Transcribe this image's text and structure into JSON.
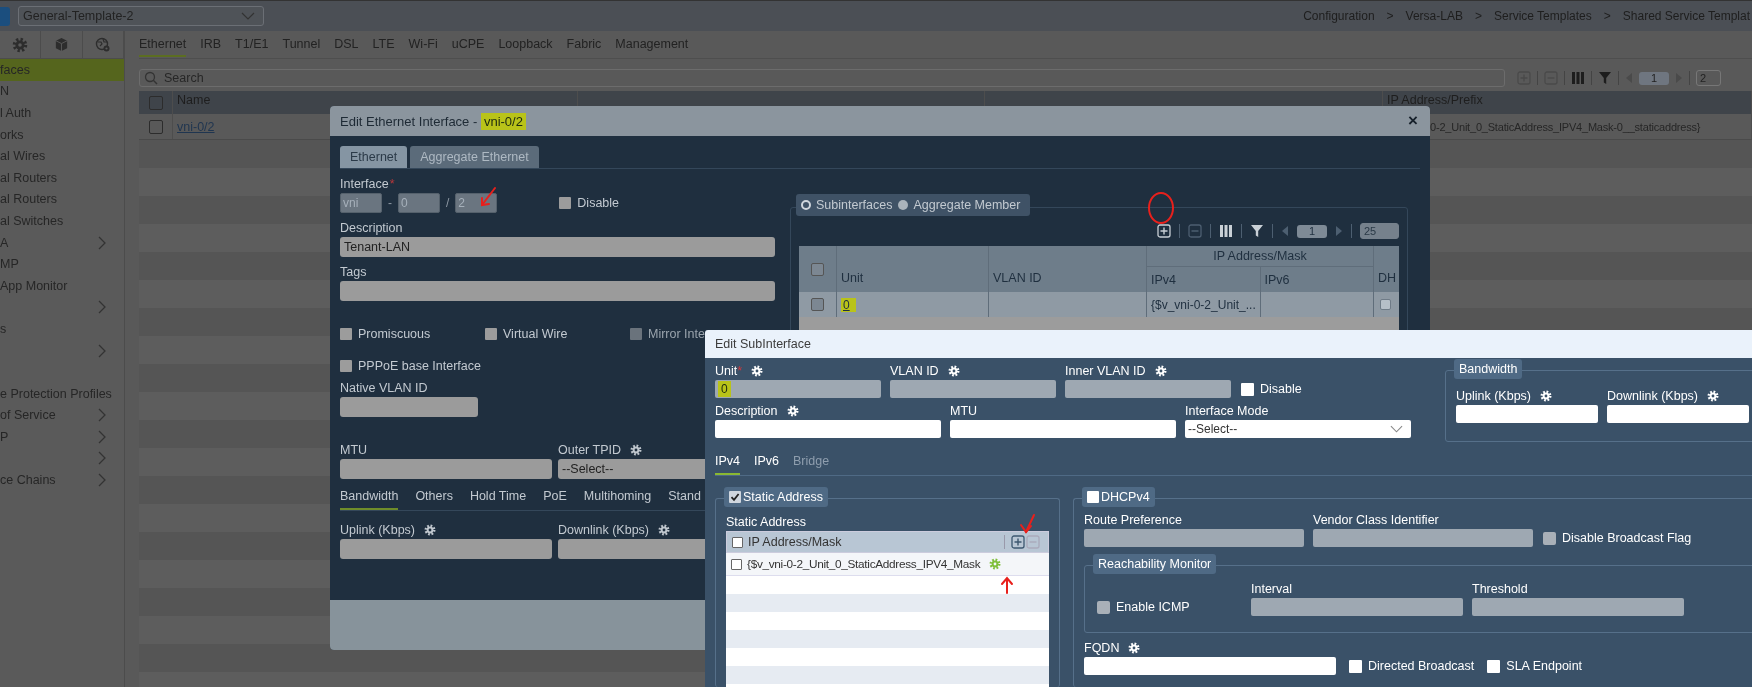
{
  "top_bar": {
    "template": "General-Template-2",
    "breadcrumb": [
      {
        "label": "Configuration"
      },
      {
        "separator": ">",
        "label": "Versa-LAB"
      },
      {
        "separator": ">",
        "label": "Service Templates"
      },
      {
        "separator": ">",
        "label": "Shared Service Templat"
      }
    ]
  },
  "sidebar": {
    "items": [
      {
        "label": "faces",
        "selected": true,
        "expandable": false
      },
      {
        "label": "N",
        "selected": false,
        "expandable": false
      },
      {
        "label": "l Auth",
        "selected": false,
        "expandable": false
      },
      {
        "label": "orks",
        "selected": false,
        "expandable": false
      },
      {
        "label": "al Wires",
        "selected": false,
        "expandable": false
      },
      {
        "label": "al Routers",
        "selected": false,
        "expandable": false
      },
      {
        "label": "al Routers",
        "selected": false,
        "expandable": false
      },
      {
        "label": "al Switches",
        "selected": false,
        "expandable": false
      },
      {
        "label": "A",
        "selected": false,
        "expandable": true
      },
      {
        "label": "MP",
        "selected": false,
        "expandable": false
      },
      {
        "label": "App Monitor",
        "selected": false,
        "expandable": false
      },
      {
        "selected": false,
        "expandable": true
      },
      {
        "label": "s",
        "selected": false,
        "expandable": false
      },
      {
        "selected": false,
        "expandable": true
      },
      {
        "selected": false,
        "expandable": false
      },
      {
        "label": "e Protection Profiles",
        "selected": false,
        "expandable": false
      },
      {
        "label": "of Service",
        "selected": false,
        "expandable": true
      },
      {
        "label": "P",
        "selected": false,
        "expandable": true
      },
      {
        "selected": false,
        "expandable": true
      },
      {
        "label": "ce Chains",
        "selected": false,
        "expandable": true
      }
    ]
  },
  "main": {
    "tabs": [
      {
        "label": "Ethernet",
        "selected": true
      },
      {
        "label": "IRB",
        "selected": false
      },
      {
        "label": "T1/E1",
        "selected": false
      },
      {
        "label": "Tunnel",
        "selected": false
      },
      {
        "label": "DSL",
        "selected": false
      },
      {
        "label": "LTE",
        "selected": false
      },
      {
        "label": "Wi-Fi",
        "selected": false
      },
      {
        "label": "uCPE",
        "selected": false
      },
      {
        "label": "Loopback",
        "selected": false
      },
      {
        "label": "Fabric",
        "selected": false
      },
      {
        "label": "Management",
        "selected": false
      }
    ],
    "search": {
      "placeholder": "Search"
    },
    "pager": {
      "page": "1",
      "page_size": "2"
    },
    "table": {
      "header_checked": false,
      "columns": {
        "name": "Name",
        "ip_prefix": "IP Address/Prefix"
      },
      "rows": [
        {
          "checked": false,
          "name": "vni-0/2",
          "ip_prefix": "0-2_Unit_0_StaticAddress_IPV4_Mask-0__staticaddress}"
        }
      ]
    }
  },
  "edit_interface": {
    "title": "Edit Ethernet Interface - ",
    "title_tag": {
      "text": "vni-0/2",
      "highlighted": true
    },
    "close": "×",
    "tabs": [
      {
        "label": "Ethernet",
        "selected": true
      },
      {
        "label": "Aggregate Ethernet",
        "selected": false
      }
    ],
    "interface": {
      "label": "Interface",
      "required_mark": "*",
      "parts": [
        {
          "value": "vni"
        },
        {
          "separator": "-",
          "value": "0"
        },
        {
          "separator": "/",
          "value": "2"
        }
      ]
    },
    "disable": {
      "label": "Disable",
      "checked": false
    },
    "description": {
      "label": "Description",
      "value": "Tenant-LAN"
    },
    "tags": {
      "label": "Tags"
    },
    "options": [
      {
        "label": "Promiscuous",
        "checked": false,
        "disabled": false
      },
      {
        "label": "Virtual Wire",
        "checked": false,
        "disabled": false
      },
      {
        "label": "Mirror Inte",
        "checked": false,
        "disabled": true
      }
    ],
    "pppoe": {
      "label": "PPPoE base Interface",
      "checked": false
    },
    "native_vlan": {
      "label": "Native VLAN ID"
    },
    "mtu": {
      "label": "MTU"
    },
    "outer_tpid": {
      "label": "Outer TPID",
      "value": "--Select--"
    },
    "subtabs": [
      {
        "label": "Bandwidth",
        "selected": true
      },
      {
        "label": "Others",
        "selected": false
      },
      {
        "label": "Hold Time",
        "selected": false
      },
      {
        "label": "PoE",
        "selected": false
      },
      {
        "label": "Multihoming",
        "selected": false
      },
      {
        "label": "Stand",
        "selected": false
      }
    ],
    "uplink": {
      "label": "Uplink (Kbps)"
    },
    "downlink": {
      "label": "Downlink (Kbps)"
    },
    "members": {
      "options": [
        {
          "label": "Subinterfaces",
          "selected": true
        },
        {
          "label": "Aggregate Member",
          "selected": false
        }
      ],
      "pager": {
        "page": "1",
        "page_size": "25"
      },
      "table": {
        "header_checked": false,
        "columns": {
          "unit": "Unit",
          "vlan": "VLAN ID",
          "ip_group": "IP Address/Mask",
          "ipv4": "IPv4",
          "ipv6": "IPv6",
          "dhcp": "DH"
        },
        "rows": [
          {
            "checked": false,
            "unit": "0",
            "unit_highlighted": true,
            "ipv4": "{$v_vni-0-2_Unit_...",
            "dhcp": false
          }
        ]
      }
    }
  },
  "edit_subinterface": {
    "title": "Edit SubInterface",
    "fields": [
      {
        "label": "Unit",
        "required_mark": "*",
        "settings": true,
        "value": "0",
        "highlighted": true
      },
      {
        "label": "VLAN ID",
        "settings": true
      },
      {
        "label": "Inner VLAN ID",
        "settings": true
      }
    ],
    "disable": {
      "label": "Disable",
      "checked": false
    },
    "bandwidth": {
      "legend": "Bandwidth",
      "uplink": "Uplink (Kbps)",
      "downlink": "Downlink (Kbps)"
    },
    "fields_2": [
      {
        "kind": "input",
        "label": "Description",
        "settings": true
      },
      {
        "kind": "input",
        "label": "MTU",
        "settings": false
      },
      {
        "kind": "select",
        "label": "Interface Mode",
        "settings": false,
        "value": "--Select--"
      }
    ],
    "tabs": [
      {
        "label": "IPv4",
        "selected": true,
        "disabled": false
      },
      {
        "label": "IPv6",
        "selected": false,
        "disabled": false
      },
      {
        "label": "Bridge",
        "selected": false,
        "disabled": true
      }
    ],
    "static": {
      "legend": "Static Address",
      "checked": true,
      "label": "Static Address",
      "header_checked": false,
      "column": "IP Address/Mask",
      "rows": [
        {
          "checked": false,
          "value": "{$v_vni-0-2_Unit_0_StaticAddress_IPV4_Mask"
        }
      ]
    },
    "dhcp": {
      "legend": "DHCPv4",
      "checked": false,
      "route_preference": "Route Preference",
      "vendor_class": "Vendor Class Identifier",
      "broadcast": {
        "label": "Disable Broadcast Flag",
        "checked": false
      },
      "monitor": {
        "legend": "Reachability Monitor",
        "icmp": {
          "label": "Enable ICMP",
          "checked": false
        },
        "interval": "Interval",
        "threshold": "Threshold"
      }
    },
    "fqdn": {
      "label": "FQDN"
    },
    "directed_broadcast": {
      "label": "Directed Broadcast",
      "checked": false
    },
    "sla_endpoint": {
      "label": "SLA Endpoint",
      "checked": false
    }
  }
}
